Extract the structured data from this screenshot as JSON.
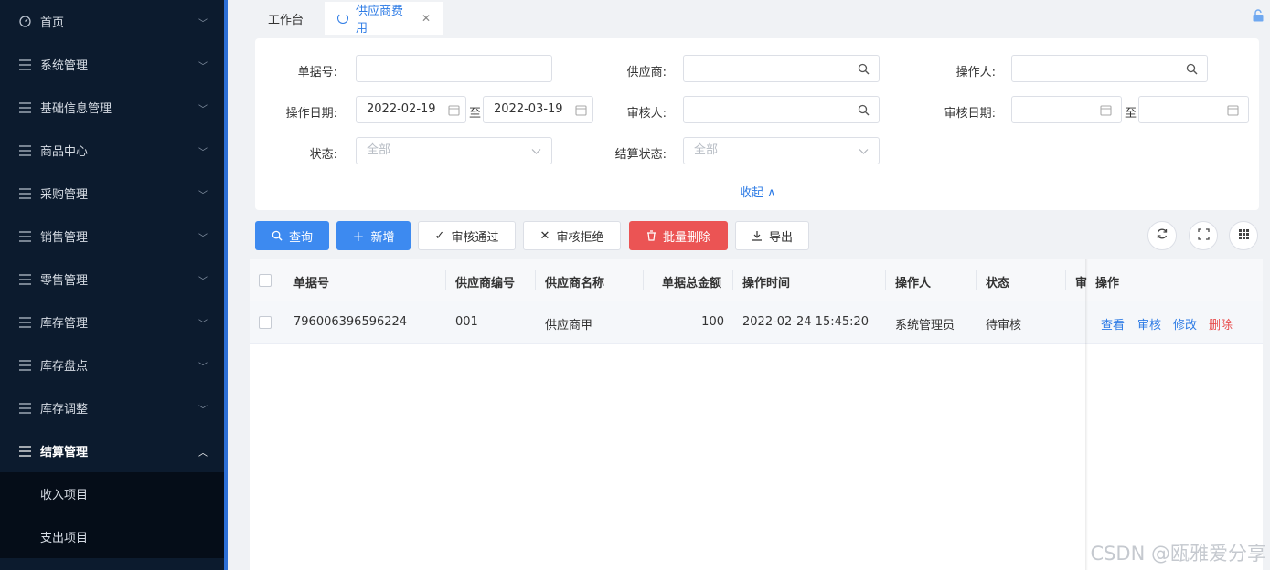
{
  "sidebar": {
    "items": [
      {
        "label": "首页",
        "icon": "dashboard-icon"
      },
      {
        "label": "系统管理",
        "icon": "menu-icon"
      },
      {
        "label": "基础信息管理",
        "icon": "menu-icon"
      },
      {
        "label": "商品中心",
        "icon": "menu-icon"
      },
      {
        "label": "采购管理",
        "icon": "menu-icon"
      },
      {
        "label": "销售管理",
        "icon": "menu-icon"
      },
      {
        "label": "零售管理",
        "icon": "menu-icon"
      },
      {
        "label": "库存管理",
        "icon": "menu-icon"
      },
      {
        "label": "库存盘点",
        "icon": "menu-icon"
      },
      {
        "label": "库存调整",
        "icon": "menu-icon"
      },
      {
        "label": "结算管理",
        "icon": "menu-icon"
      }
    ],
    "submenu": [
      "收入项目",
      "支出项目"
    ]
  },
  "tabs": [
    {
      "label": "工作台"
    },
    {
      "label": "供应商费用"
    }
  ],
  "filter": {
    "doc_no_label": "单据号:",
    "supplier_label": "供应商:",
    "operator_label": "操作人:",
    "op_date_label": "操作日期:",
    "op_date_start": "2022-02-19",
    "op_date_end": "2022-03-19",
    "range_sep": "至",
    "auditor_label": "审核人:",
    "audit_date_label": "审核日期:",
    "status_label": "状态:",
    "status_value": "全部",
    "settle_label": "结算状态:",
    "settle_value": "全部",
    "collapse_label": "收起"
  },
  "toolbar": {
    "query": "查询",
    "add": "新增",
    "approve": "审核通过",
    "reject": "审核拒绝",
    "batch_delete": "批量删除",
    "export": "导出"
  },
  "table": {
    "headers": {
      "doc_no": "单据号",
      "supplier_code": "供应商编号",
      "supplier_name": "供应商名称",
      "total": "单据总金额",
      "op_time": "操作时间",
      "operator": "操作人",
      "status": "状态",
      "audit": "审",
      "actions": "操作"
    },
    "rows": [
      {
        "doc_no": "796006396596224",
        "supplier_code": "001",
        "supplier_name": "供应商甲",
        "total": "100",
        "op_time": "2022-02-24 15:45:20",
        "operator": "系统管理员",
        "status": "待审核"
      }
    ],
    "actions": {
      "view": "查看",
      "audit": "审核",
      "edit": "修改",
      "delete": "删除"
    }
  },
  "watermark": "CSDN @瓯雅爱分享",
  "colors": {
    "sidebar_bg": "#0c1b2e",
    "primary": "#3d8af0",
    "danger": "#eb5454",
    "link": "#2d7be5"
  }
}
